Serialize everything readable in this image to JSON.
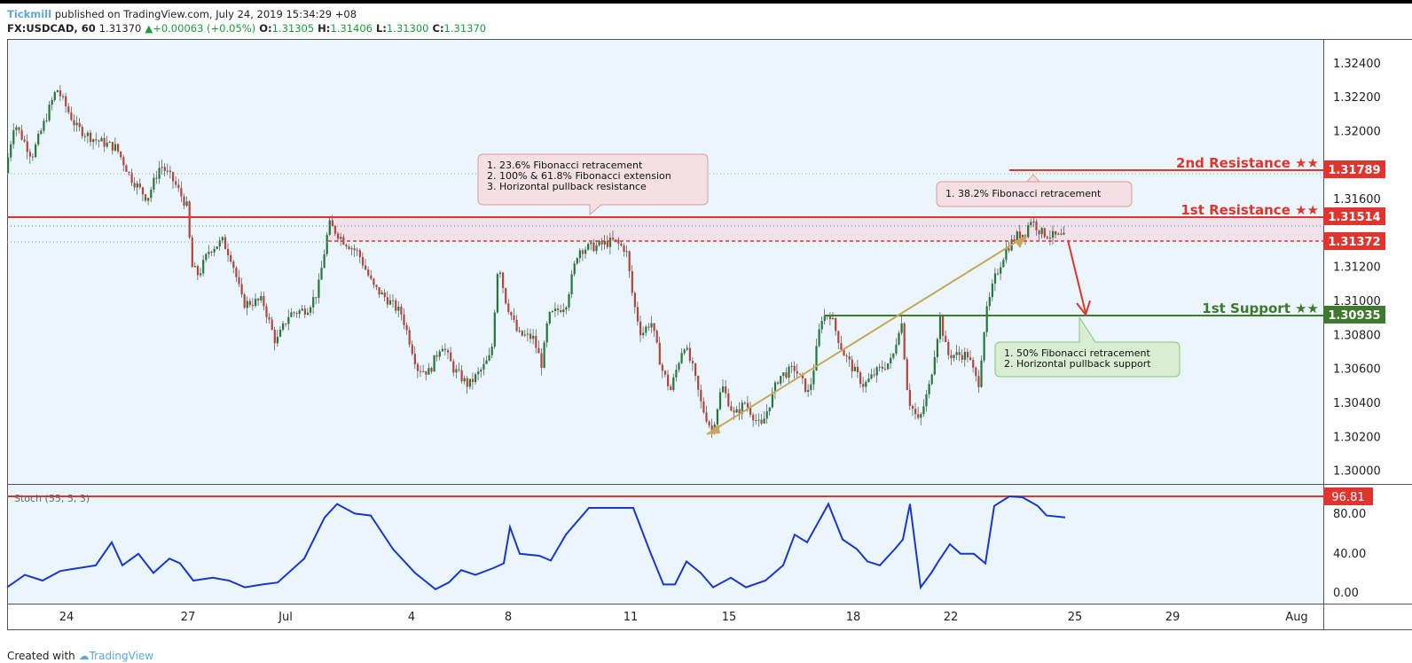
{
  "header": {
    "publisher": "Tickmill",
    "published_text": "published on TradingView.com, July 24, 2019 15:34:29 +08",
    "symbol": "FX:USDCAD, 60",
    "last": "1.31370",
    "change": "+0.00063 (+0.05%)",
    "o_label": "O:",
    "o": "1.31305",
    "h_label": "H:",
    "h": "1.31406",
    "l_label": "L:",
    "l": "1.31300",
    "c_label": "C:",
    "c": "1.31370"
  },
  "footer": {
    "created_with": "Created with",
    "brand": "TradingView"
  },
  "colors": {
    "background": "#eaf6fb",
    "bull": "#27763a",
    "bear": "#b5443b",
    "resistance": "#e0352f",
    "support": "#3e7a2c",
    "stoch": "#1a36cc",
    "trendline": "#c8a65a"
  },
  "chart_data": {
    "type": "candlestick",
    "symbol": "FX:USDCAD",
    "interval": "60",
    "x_ticks": [
      "24",
      "27",
      "Jul",
      "4",
      "8",
      "11",
      "15",
      "18",
      "22",
      "25",
      "29",
      "Aug"
    ],
    "y_ticks": [
      "1.32400",
      "1.32200",
      "1.32000",
      "1.31600",
      "1.31200",
      "1.31000",
      "1.30800",
      "1.30600",
      "1.30400",
      "1.30200",
      "1.30000"
    ],
    "ylim": [
      1.2992,
      1.3254
    ],
    "price_path": [
      [
        0,
        1.3175
      ],
      [
        10,
        1.3205
      ],
      [
        30,
        1.3185
      ],
      [
        58,
        1.3225
      ],
      [
        80,
        1.3202
      ],
      [
        100,
        1.3195
      ],
      [
        125,
        1.319
      ],
      [
        142,
        1.3172
      ],
      [
        160,
        1.316
      ],
      [
        175,
        1.318
      ],
      [
        190,
        1.317
      ],
      [
        205,
        1.3155
      ],
      [
        210,
        1.312
      ],
      [
        218,
        1.3115
      ],
      [
        230,
        1.313
      ],
      [
        245,
        1.3135
      ],
      [
        255,
        1.3125
      ],
      [
        268,
        1.3098
      ],
      [
        290,
        1.31
      ],
      [
        305,
        1.3075
      ],
      [
        320,
        1.3092
      ],
      [
        340,
        1.3095
      ],
      [
        352,
        1.3105
      ],
      [
        365,
        1.3145
      ],
      [
        382,
        1.3135
      ],
      [
        398,
        1.3128
      ],
      [
        415,
        1.3108
      ],
      [
        432,
        1.31
      ],
      [
        447,
        1.3092
      ],
      [
        465,
        1.306
      ],
      [
        478,
        1.3058
      ],
      [
        492,
        1.3075
      ],
      [
        505,
        1.306
      ],
      [
        522,
        1.305
      ],
      [
        538,
        1.306
      ],
      [
        548,
        1.3068
      ],
      [
        556,
        1.3125
      ],
      [
        563,
        1.3102
      ],
      [
        578,
        1.308
      ],
      [
        595,
        1.3078
      ],
      [
        605,
        1.3062
      ],
      [
        612,
        1.309
      ],
      [
        632,
        1.3098
      ],
      [
        646,
        1.313
      ],
      [
        666,
        1.3132
      ],
      [
        686,
        1.3135
      ],
      [
        700,
        1.313
      ],
      [
        708,
        1.31
      ],
      [
        717,
        1.308
      ],
      [
        728,
        1.3088
      ],
      [
        740,
        1.306
      ],
      [
        750,
        1.3047
      ],
      [
        765,
        1.3075
      ],
      [
        775,
        1.306
      ],
      [
        785,
        1.3038
      ],
      [
        797,
        1.3023
      ],
      [
        808,
        1.305
      ],
      [
        822,
        1.3032
      ],
      [
        834,
        1.304
      ],
      [
        852,
        1.3025
      ],
      [
        872,
        1.3055
      ],
      [
        890,
        1.306
      ],
      [
        906,
        1.3045
      ],
      [
        912,
        1.3062
      ],
      [
        920,
        1.309
      ],
      [
        930,
        1.3092
      ],
      [
        944,
        1.307
      ],
      [
        958,
        1.3058
      ],
      [
        968,
        1.305
      ],
      [
        982,
        1.3058
      ],
      [
        1000,
        1.3065
      ],
      [
        1010,
        1.309
      ],
      [
        1018,
        1.3042
      ],
      [
        1030,
        1.3028
      ],
      [
        1042,
        1.305
      ],
      [
        1054,
        1.309
      ],
      [
        1062,
        1.3068
      ],
      [
        1072,
        1.3068
      ],
      [
        1085,
        1.3068
      ],
      [
        1097,
        1.305
      ],
      [
        1105,
        1.309
      ],
      [
        1115,
        1.3112
      ],
      [
        1128,
        1.313
      ],
      [
        1140,
        1.3138
      ],
      [
        1150,
        1.314
      ],
      [
        1156,
        1.3148
      ],
      [
        1168,
        1.314
      ],
      [
        1180,
        1.3138
      ],
      [
        1193,
        1.3137
      ]
    ],
    "stochastic": {
      "label": "Stoch (55, 5, 3)",
      "levels": [
        "80.00",
        "40.00",
        "0.00"
      ],
      "last": "96.81",
      "ylim": [
        0,
        100
      ],
      "values": [
        [
          0,
          5
        ],
        [
          20,
          18
        ],
        [
          40,
          12
        ],
        [
          60,
          22
        ],
        [
          80,
          25
        ],
        [
          100,
          28
        ],
        [
          118,
          52
        ],
        [
          130,
          28
        ],
        [
          148,
          40
        ],
        [
          165,
          20
        ],
        [
          183,
          35
        ],
        [
          195,
          30
        ],
        [
          210,
          12
        ],
        [
          232,
          15
        ],
        [
          250,
          12
        ],
        [
          268,
          5
        ],
        [
          288,
          8
        ],
        [
          305,
          10
        ],
        [
          335,
          35
        ],
        [
          358,
          78
        ],
        [
          372,
          92
        ],
        [
          392,
          82
        ],
        [
          410,
          80
        ],
        [
          435,
          45
        ],
        [
          460,
          20
        ],
        [
          483,
          3
        ],
        [
          498,
          10
        ],
        [
          512,
          23
        ],
        [
          528,
          18
        ],
        [
          548,
          25
        ],
        [
          560,
          30
        ],
        [
          567,
          68
        ],
        [
          578,
          40
        ],
        [
          600,
          38
        ],
        [
          613,
          33
        ],
        [
          630,
          60
        ],
        [
          656,
          88
        ],
        [
          680,
          88
        ],
        [
          706,
          88
        ],
        [
          725,
          42
        ],
        [
          740,
          8
        ],
        [
          753,
          8
        ],
        [
          766,
          32
        ],
        [
          782,
          20
        ],
        [
          796,
          5
        ],
        [
          816,
          15
        ],
        [
          833,
          5
        ],
        [
          855,
          12
        ],
        [
          875,
          28
        ],
        [
          888,
          60
        ],
        [
          902,
          52
        ],
        [
          926,
          92
        ],
        [
          942,
          55
        ],
        [
          958,
          45
        ],
        [
          970,
          32
        ],
        [
          984,
          28
        ],
        [
          1001,
          45
        ],
        [
          1010,
          55
        ],
        [
          1018,
          92
        ],
        [
          1030,
          5
        ],
        [
          1042,
          20
        ],
        [
          1050,
          32
        ],
        [
          1063,
          50
        ],
        [
          1075,
          40
        ],
        [
          1090,
          40
        ],
        [
          1103,
          30
        ],
        [
          1113,
          90
        ],
        [
          1130,
          100
        ],
        [
          1145,
          99
        ],
        [
          1162,
          90
        ],
        [
          1172,
          80
        ],
        [
          1193,
          78
        ]
      ]
    },
    "levels": {
      "resistance_2": {
        "label": "2nd Resistance ★★",
        "value": "1.31789"
      },
      "resistance_1": {
        "label": "1st Resistance ★★",
        "value": "1.31514"
      },
      "current": {
        "value": "1.31372"
      },
      "support_1": {
        "label": "1st Support ★★",
        "value": "1.30935"
      }
    },
    "annotations": {
      "box1": [
        "1.  23.6% Fibonacci retracement",
        "2. 100% & 61.8% Fibonacci extension",
        "3. Horizontal pullback resistance"
      ],
      "box2": [
        "1. 38.2% Fibonacci retracement"
      ],
      "box3": [
        "1. 50% Fibonacci retracement",
        "2. Horizontal pullback support"
      ]
    }
  }
}
